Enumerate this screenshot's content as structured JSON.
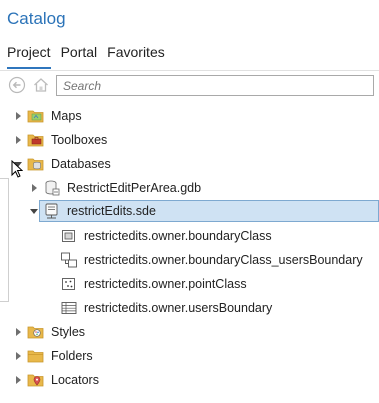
{
  "panel": {
    "title": "Catalog"
  },
  "tabs": [
    {
      "label": "Project",
      "active": true
    },
    {
      "label": "Portal",
      "active": false
    },
    {
      "label": "Favorites",
      "active": false
    }
  ],
  "search": {
    "placeholder": "Search"
  },
  "tree": {
    "maps": "Maps",
    "toolboxes": "Toolboxes",
    "databases": "Databases",
    "gdb": "RestrictEditPerArea.gdb",
    "sde": "restrictEdits.sde",
    "children": [
      {
        "label": "restrictedits.owner.boundaryClass",
        "icon": "polygon-feature-class-icon"
      },
      {
        "label": "restrictedits.owner.boundaryClass_usersBoundary",
        "icon": "relationship-class-icon"
      },
      {
        "label": "restrictedits.owner.pointClass",
        "icon": "point-feature-class-icon"
      },
      {
        "label": "restrictedits.owner.usersBoundary",
        "icon": "table-icon"
      }
    ],
    "styles": "Styles",
    "folders": "Folders",
    "locators": "Locators"
  },
  "colors": {
    "title": "#2b73b8",
    "selection": "#cfe2f3",
    "selection_border": "#7ea9d0",
    "folder": "#e8b84a"
  }
}
